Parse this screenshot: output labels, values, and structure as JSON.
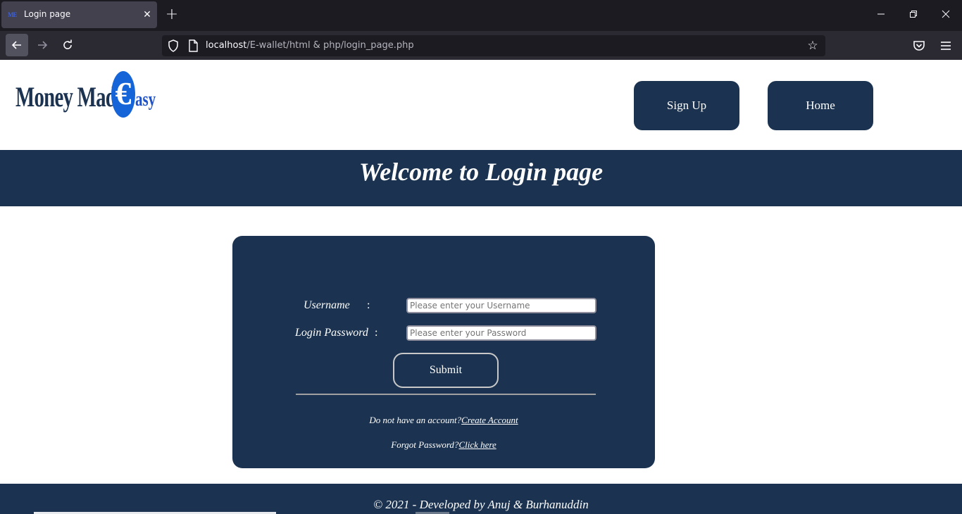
{
  "browser": {
    "tab_title": "Login page",
    "tab_close": "✕",
    "new_tab": "+",
    "url_host": "localhost",
    "url_path": "/E-wallet/html & php/login_page.php",
    "window_controls": {
      "minimize": "—",
      "restore": "❐",
      "close": "✕"
    },
    "nav": {
      "back": "←",
      "forward": "→",
      "reload": "↻",
      "bookmark_star": "☆"
    },
    "icons": {
      "favicon": "money-made-easy-favicon",
      "shield": "shield-icon",
      "page": "page-icon",
      "pocket": "pocket-icon",
      "menu": "hamburger-menu-icon"
    }
  },
  "header": {
    "logo": {
      "text": "Money Made",
      "symbol": "€",
      "tail": "asy"
    },
    "buttons": {
      "signup": "Sign Up",
      "home": "Home"
    }
  },
  "banner": {
    "title": "Welcome to Login page"
  },
  "login_form": {
    "username_label": "Username",
    "password_label": "Login Password",
    "colon": ":",
    "username_placeholder": "Please enter your Username",
    "password_placeholder": "Please enter your Password",
    "submit_label": "Submit",
    "no_account_text": "Do not have an account?",
    "create_account_link": "Create Account",
    "forgot_text": "Forgot Password?",
    "forgot_link": "Click here"
  },
  "footer": {
    "text": "© 2021 - Developed by Anuj & Burhanuddin"
  },
  "colors": {
    "brand_navy": "#1b3350",
    "logo_blue": "#1565d8",
    "browser_dark": "#1c1b22",
    "browser_toolbar": "#2b2a33"
  }
}
